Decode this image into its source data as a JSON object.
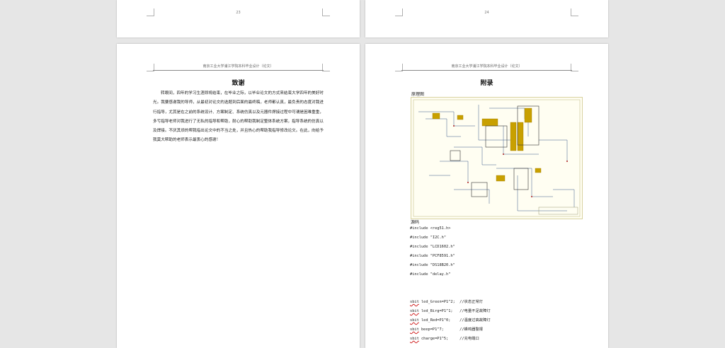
{
  "pages": {
    "top_left": {
      "page_number": "23"
    },
    "top_right": {
      "page_number": "24"
    }
  },
  "header_text": "南京工业大学浦江学院本科毕业设计（论文）",
  "ack": {
    "heading": "致谢",
    "paragraph": "转眼间，四年的学习生涯即将结束，在毕业之际，以毕业论文的方式来结束大学四年的美好时光。我要感谢我的导师，从最初对论文的选题到后面的最终稿，老师都认真，最负责的态度对我进行指导，尤其是在之前的系统设计、方案制定、系统仿真以及元器件焊接过程中可谓是困难重重，多亏指导老师对我进行了无私的指导和帮助，耐心的帮助我制定整体系统方案，指导系统的仿真以及焊接。不厌其烦的帮我指出论文中的不当之处，并且热心的帮助我指导修改论文。在此，向给予我莫大帮助的老师表示最衷心的感谢！"
  },
  "appendix": {
    "heading": "附录",
    "schematic_label": "原理图",
    "source_label": "源码",
    "includes": [
      "#include <reg51.h>",
      "#include \"I2C.h\"",
      "#include \"LCD1602.h\"",
      "#include \"PCF8591.h\"",
      "#include \"DS18B20.h\"",
      "#include \"delay.h\""
    ],
    "sbits": [
      {
        "keyword": "sbit",
        "code": " led_Green=P1^2;  ",
        "comment": "//状态正常灯"
      },
      {
        "keyword": "sbit",
        "code": " led_Birg=P1^1;   ",
        "comment": "//电量不足故障灯"
      },
      {
        "keyword": "sbit",
        "code": " led_Red=P1^0;    ",
        "comment": "//温度过高故障灯"
      },
      {
        "keyword": "sbit",
        "code": " beep=P1^7;       ",
        "comment": "//蜂鸣器警报"
      },
      {
        "keyword": "sbit",
        "code": " charge=P1^5;     ",
        "comment": "//充电端口"
      }
    ]
  },
  "colors": {
    "spellcheck": "#d02020",
    "schematic_wire": "#3a5a8c",
    "schematic_part": "#c8a000"
  }
}
